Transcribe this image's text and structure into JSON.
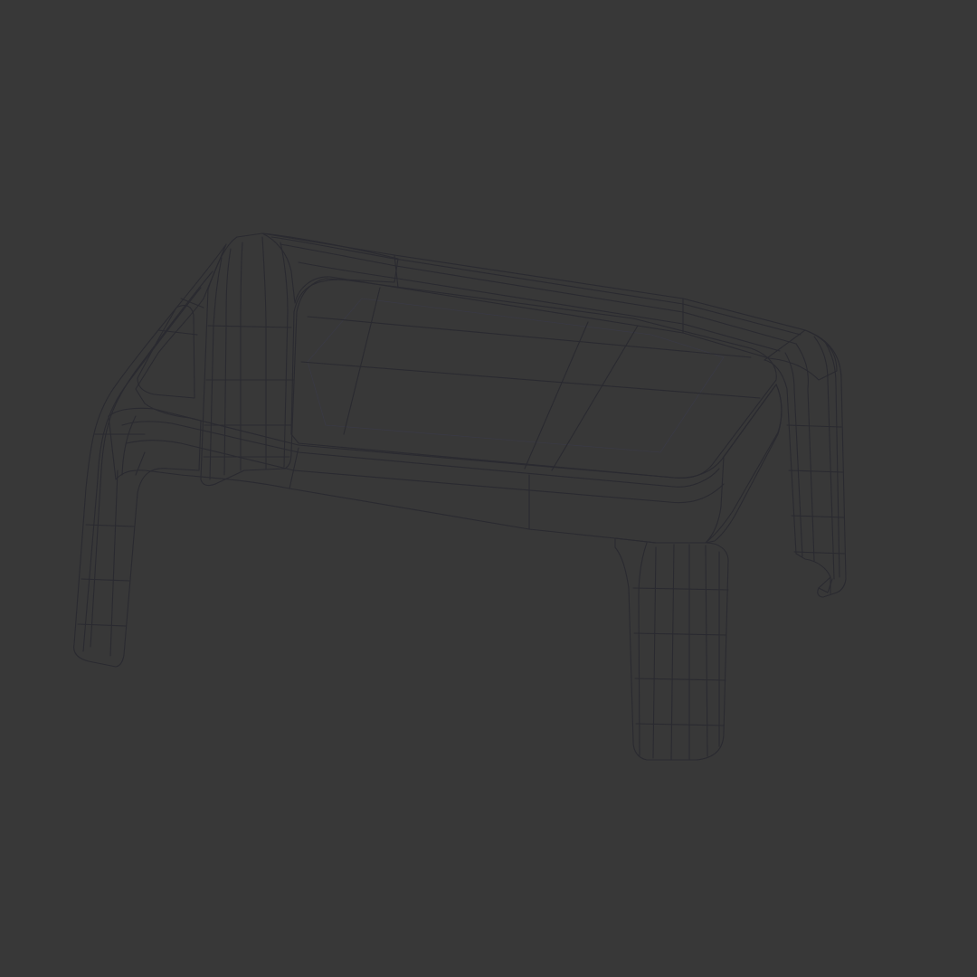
{
  "scene": {
    "background_color": "#383838",
    "subject": "plastic-table-wireframe-render",
    "colors": {
      "surface_light": "#d9d8e6",
      "surface_mid": "#c4c3d6",
      "surface_shade": "#a9a8bf",
      "inner_top": "#6c7080",
      "inner_top_light": "#808595",
      "underside": "#c9c9c4",
      "wire": "#2a2a30"
    }
  }
}
